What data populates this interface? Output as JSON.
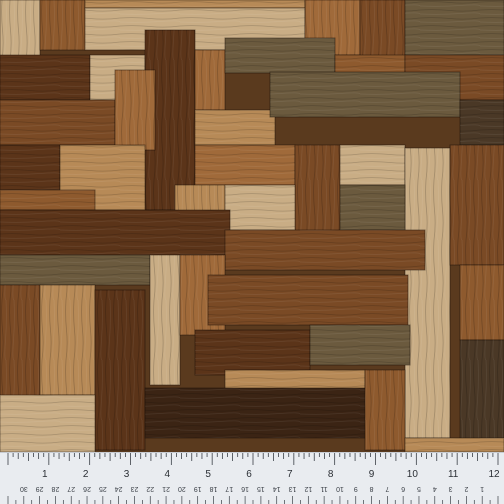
{
  "image": {
    "subject": "wood plank patchwork fabric print",
    "palette": [
      "#3b2414",
      "#5b3419",
      "#7a4a25",
      "#8e5a2e",
      "#a06a3a",
      "#b78a57",
      "#c9ad85",
      "#6b5a3e",
      "#4a3826"
    ]
  },
  "ruler": {
    "color": "#e9ecf0",
    "inches_labels": [
      "1",
      "2",
      "3",
      "4",
      "5",
      "6",
      "7",
      "8",
      "9",
      "10",
      "11",
      "12"
    ],
    "cm_labels": [
      "30",
      "29",
      "28",
      "27",
      "26",
      "25",
      "24",
      "23",
      "22",
      "21",
      "20",
      "19",
      "18",
      "17",
      "16",
      "15",
      "14",
      "13",
      "12",
      "11",
      "10",
      "9",
      "8",
      "7",
      "6",
      "5",
      "4",
      "3",
      "2",
      "1"
    ]
  }
}
